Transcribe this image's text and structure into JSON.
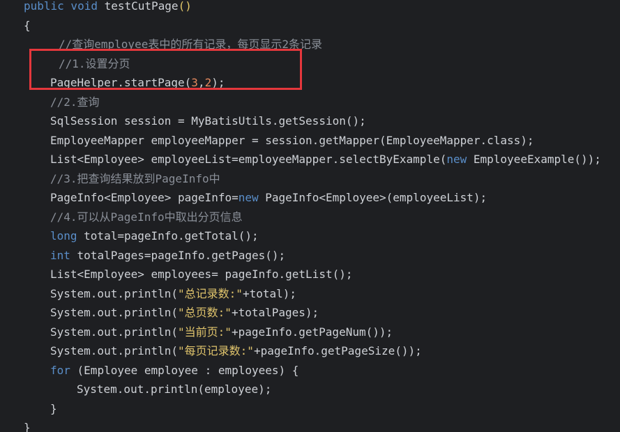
{
  "code": {
    "lines": {
      "l0": {
        "kw": "public void",
        "name": " testCutPage",
        "paren": "()"
      },
      "l1": {
        "text": "{"
      },
      "l2": {
        "comment": "//查询employee表中的所有记录，每页显示2条记录"
      },
      "l3": {
        "comment": "//1.设置分页"
      },
      "l4": {
        "pre": "PageHelper.startPage(",
        "n1": "3",
        "comma": ",",
        "n2": "2",
        "post": ");"
      },
      "l5": {
        "comment": "//2.查询"
      },
      "l6": {
        "text": "SqlSession session = MyBatisUtils.getSession();"
      },
      "l7": {
        "text": "EmployeeMapper employeeMapper = session.getMapper(EmployeeMapper.class);"
      },
      "l8": {
        "pre": "List<Employee> employeeList=employeeMapper.selectByExample(",
        "kw": "new",
        "post": " EmployeeExample());"
      },
      "l9": {
        "comment": "//3.把查询结果放到PageInfo中"
      },
      "l10": {
        "pre": "PageInfo<Employee> pageInfo=",
        "kw": "new",
        "post": " PageInfo<Employee>(employeeList);"
      },
      "l11": {
        "comment": "//4.可以从PageInfo中取出分页信息"
      },
      "l12": {
        "kw": "long",
        "post": " total=pageInfo.getTotal();"
      },
      "l13": {
        "kw": "int",
        "post": " totalPages=pageInfo.getPages();"
      },
      "l14": {
        "text": "List<Employee> employees= pageInfo.getList();"
      },
      "l15": {
        "pre": "System.out.println(",
        "str": "\"总记录数:\"",
        "post": "+total);"
      },
      "l16": {
        "pre": "System.out.println(",
        "str": "\"总页数:\"",
        "post": "+totalPages);"
      },
      "l17": {
        "pre": "System.out.println(",
        "str": "\"当前页:\"",
        "post": "+pageInfo.getPageNum());"
      },
      "l18": {
        "pre": "System.out.println(",
        "str": "\"每页记录数:\"",
        "post": "+pageInfo.getPageSize());"
      },
      "l19": {
        "kw": "for",
        "post": " (Employee employee : employees) {"
      },
      "l20": {
        "text": "System.out.println(employee);"
      },
      "l21": {
        "text": "}"
      },
      "l22": {
        "text": "}"
      }
    }
  },
  "colors": {
    "background": "#1e1f22",
    "keyword": "#5a8ec9",
    "comment": "#8a8f98",
    "string": "#e0c46c",
    "number": "#e5895e",
    "highlight_border": "#e5373c"
  }
}
